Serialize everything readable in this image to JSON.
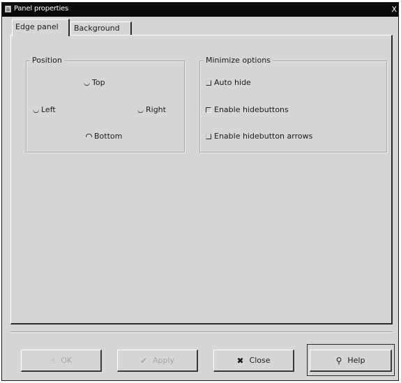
{
  "window": {
    "title": "Panel properties",
    "close_glyph": "X"
  },
  "tabs": [
    {
      "label": "Edge panel",
      "active": true
    },
    {
      "label": "Background",
      "active": false
    }
  ],
  "position": {
    "title": "Position",
    "options": [
      {
        "label": "Top",
        "selected": false
      },
      {
        "label": "Left",
        "selected": false
      },
      {
        "label": "Right",
        "selected": false
      },
      {
        "label": "Bottom",
        "selected": true
      }
    ]
  },
  "minimize": {
    "title": "Minimize options",
    "options": [
      {
        "label": "Auto hide",
        "checked": false
      },
      {
        "label": "Enable hidebuttons",
        "checked": true
      },
      {
        "label": "Enable hidebutton arrows",
        "checked": false
      }
    ]
  },
  "buttons": {
    "ok": {
      "label": "OK",
      "icon": "ok-hand-icon",
      "enabled": false
    },
    "apply": {
      "label": "Apply",
      "icon": "checkmark-icon",
      "enabled": false
    },
    "close": {
      "label": "Close",
      "icon": "close-x-icon",
      "enabled": true
    },
    "help": {
      "label": "Help",
      "icon": "lightbulb-icon",
      "enabled": true,
      "default": true
    }
  }
}
